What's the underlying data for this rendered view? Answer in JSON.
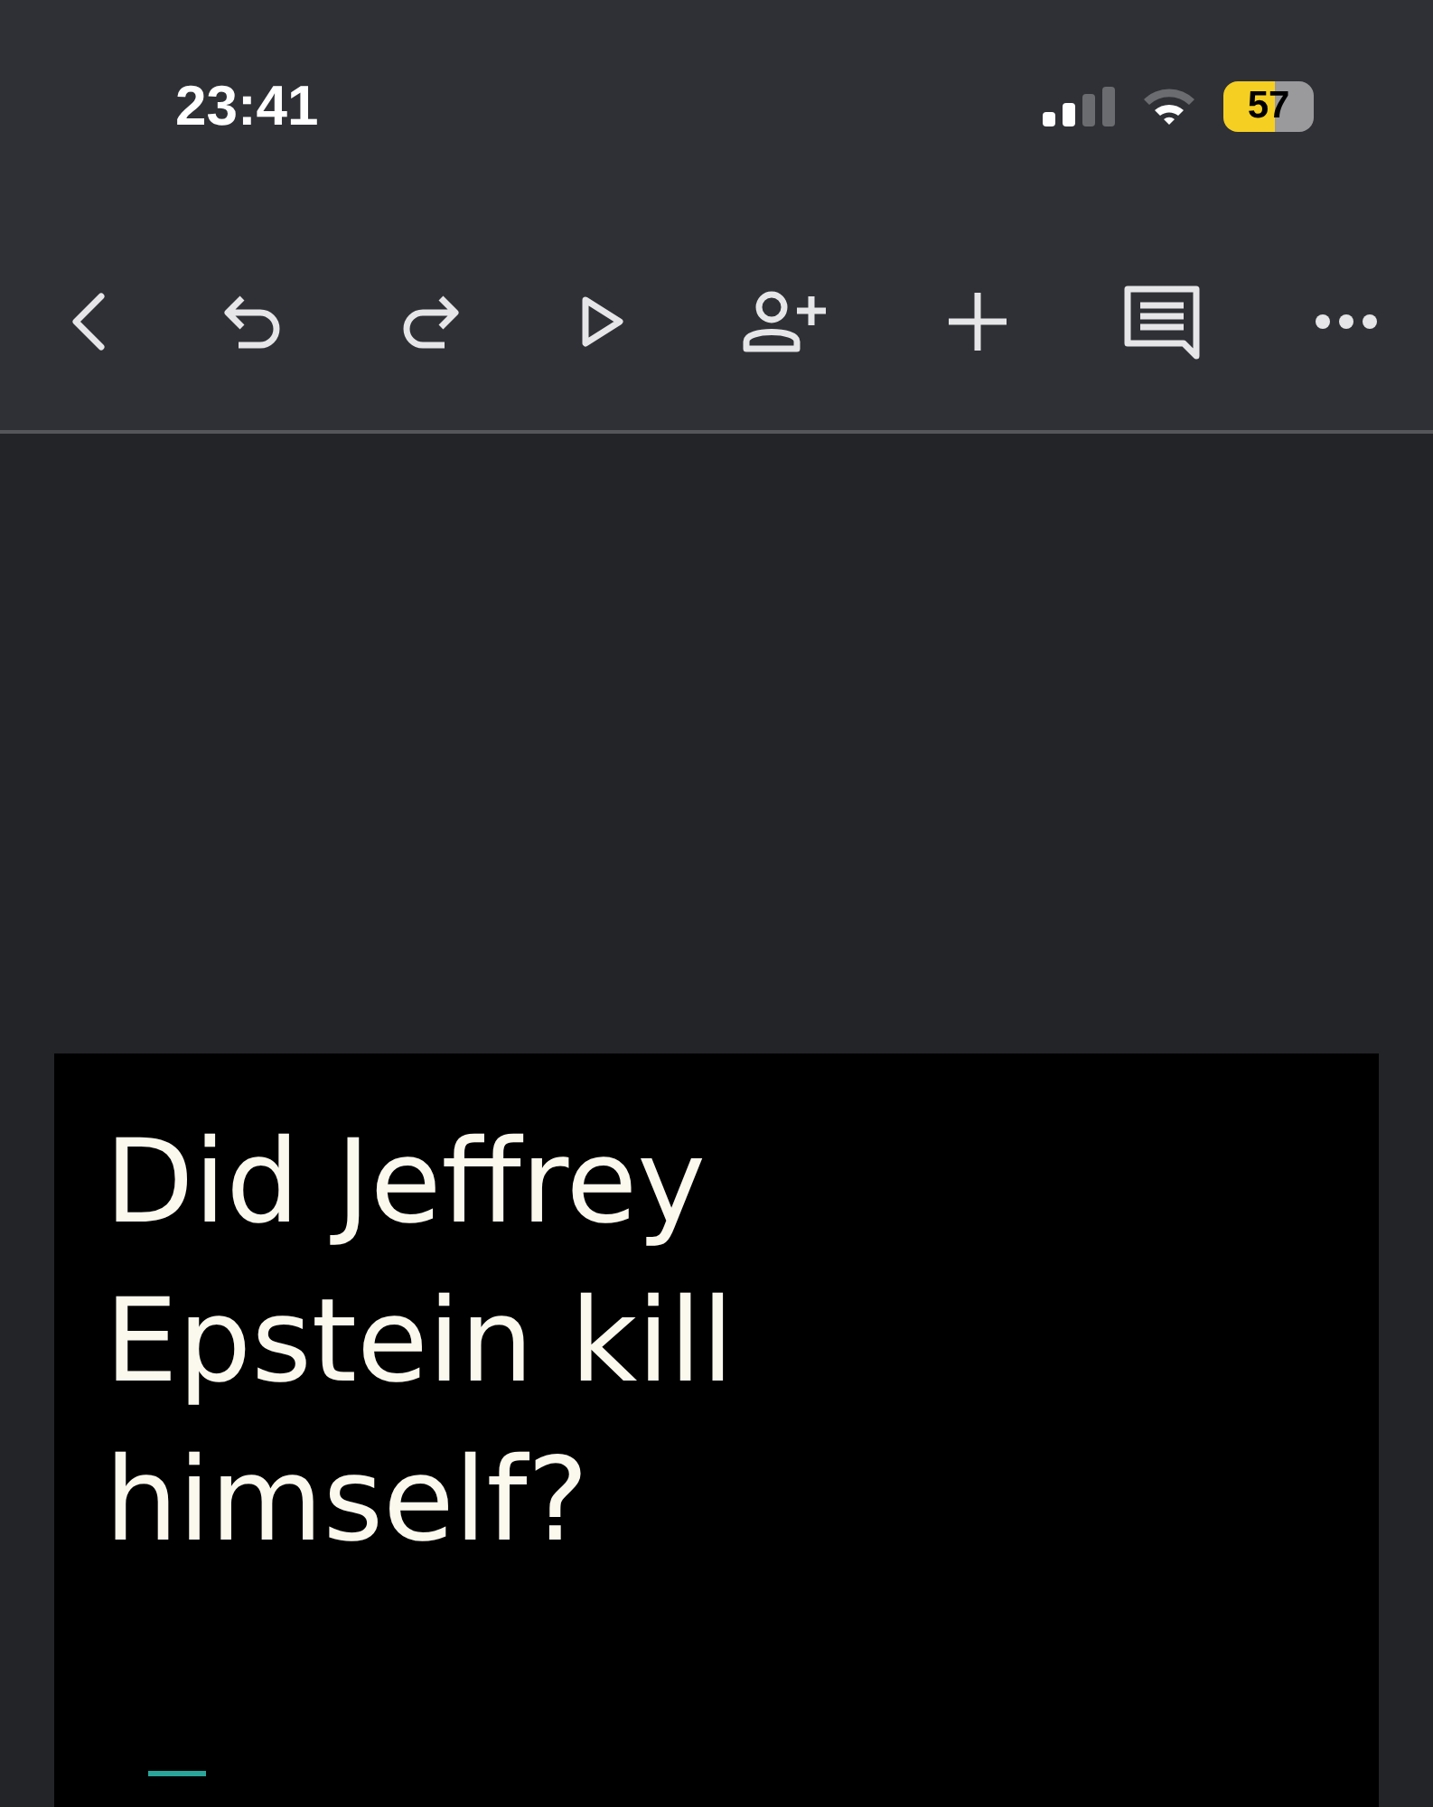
{
  "status_bar": {
    "time": "23:41",
    "battery": "57"
  },
  "slide": {
    "title": "Did Jeffrey Epstein kill himself?"
  }
}
